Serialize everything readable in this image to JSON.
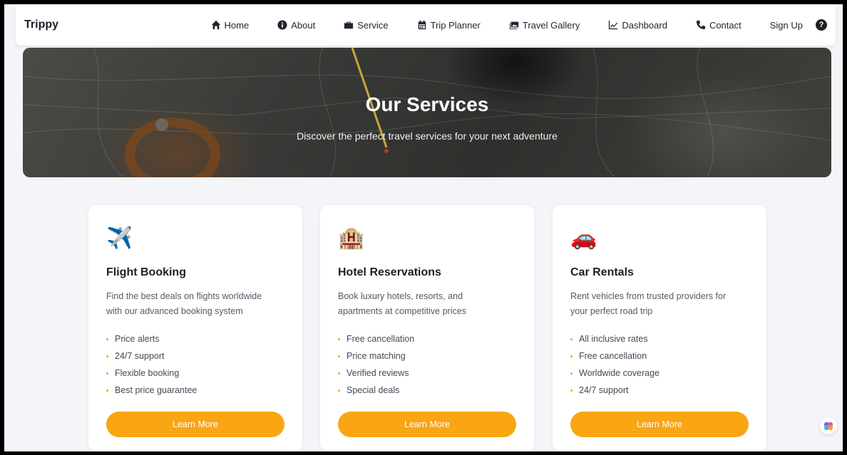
{
  "brand": "Trippy",
  "nav": {
    "home": "Home",
    "about": "About",
    "service": "Service",
    "trip_planner": "Trip Planner",
    "gallery": "Travel Gallery",
    "dashboard": "Dashboard",
    "contact": "Contact",
    "signup": "Sign Up",
    "help": "?"
  },
  "hero": {
    "title": "Our Services",
    "subtitle": "Discover the perfect travel services for your next adventure"
  },
  "cards": [
    {
      "icon": "✈️",
      "title": "Flight Booking",
      "desc": "Find the best deals on flights worldwide with our advanced booking system",
      "features": [
        "Price alerts",
        "24/7 support",
        "Flexible booking",
        "Best price guarantee"
      ],
      "button": "Learn More"
    },
    {
      "icon": "🏨",
      "title": "Hotel Reservations",
      "desc": "Book luxury hotels, resorts, and apartments at competitive prices",
      "features": [
        "Free cancellation",
        "Price matching",
        "Verified reviews",
        "Special deals"
      ],
      "button": "Learn More"
    },
    {
      "icon": "🚗",
      "title": "Car Rentals",
      "desc": "Rent vehicles from trusted providers for your perfect road trip",
      "features": [
        "All inclusive rates",
        "Free cancellation",
        "Worldwide coverage",
        "24/7 support"
      ],
      "button": "Learn More"
    }
  ],
  "colors": {
    "accent": "#f9a514",
    "background": "#f3f5f8"
  }
}
